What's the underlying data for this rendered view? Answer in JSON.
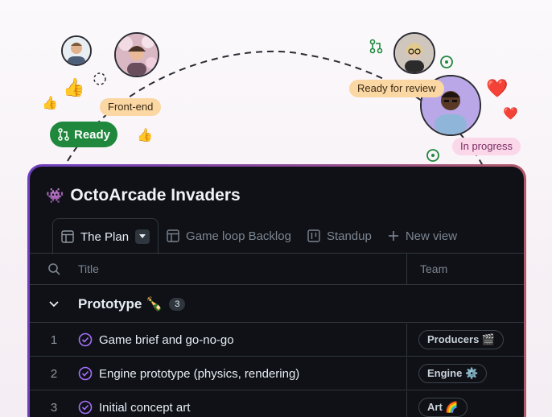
{
  "decor": {
    "labels": {
      "frontend": "Front-end",
      "ready": "Ready",
      "ready_for_review": "Ready for review",
      "in_progress": "In progress"
    },
    "emoji": {
      "thumbs_up": "👍",
      "heart": "❤️"
    },
    "colors": {
      "ready_green": "#1f883d",
      "label_orange": "#fbd7a3",
      "label_pink": "#fbd7ea"
    }
  },
  "project": {
    "icon": "👾",
    "title": "OctoArcade Invaders"
  },
  "tabs": [
    {
      "label": "The Plan",
      "icon": "table-icon",
      "active": true
    },
    {
      "label": "Game loop Backlog",
      "icon": "table-icon",
      "active": false
    },
    {
      "label": "Standup",
      "icon": "board-icon",
      "active": false
    },
    {
      "label": "New view",
      "icon": "plus-icon",
      "active": false
    }
  ],
  "columns": {
    "title": "Title",
    "team": "Team"
  },
  "group": {
    "name": "Prototype 🍾",
    "count": "3"
  },
  "rows": [
    {
      "num": "1",
      "title": "Game brief and go-no-go",
      "team": "Producers 🎬"
    },
    {
      "num": "2",
      "title": "Engine prototype (physics, rendering)",
      "team": "Engine ⚙️"
    },
    {
      "num": "3",
      "title": "Initial concept art",
      "team": "Art 🌈"
    }
  ]
}
